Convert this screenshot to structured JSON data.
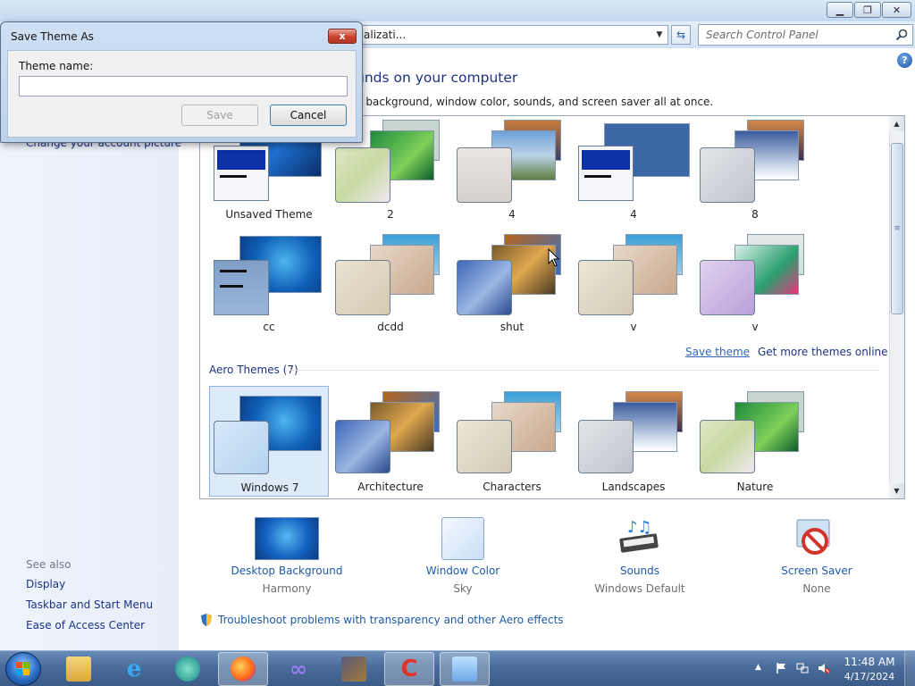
{
  "address": {
    "text": "alizati..."
  },
  "search": {
    "placeholder": "Search Control Panel"
  },
  "heading": "unds on your computer",
  "subheading": "p background, window color, sounds, and screen saver all at once.",
  "left_pane": {
    "partial_link": "Change your account picture",
    "see_also": "See also",
    "links": [
      "Display",
      "Taskbar and Start Menu",
      "Ease of Access Center"
    ]
  },
  "my_themes": [
    {
      "label": "Unsaved Theme",
      "icon": "basic-window-theme"
    },
    {
      "label": "2",
      "icon": "green-abstract-theme"
    },
    {
      "label": "4",
      "icon": "landscape-lighthouse-theme"
    },
    {
      "label": "4",
      "icon": "solid-blue-basic-theme"
    },
    {
      "label": "8",
      "icon": "sunset-landscape-theme"
    },
    {
      "label": "cc",
      "icon": "windows7-basic-theme"
    },
    {
      "label": "dcdd",
      "icon": "characters-theme"
    },
    {
      "label": "shut",
      "icon": "architecture-theme"
    },
    {
      "label": "v",
      "icon": "characters-theme"
    },
    {
      "label": "v",
      "icon": "purple-characters-theme"
    }
  ],
  "links": {
    "save_theme": "Save theme",
    "more_themes": "Get more themes online"
  },
  "aero": {
    "header": "Aero Themes (7)",
    "themes": [
      {
        "label": "Windows 7",
        "selected": true
      },
      {
        "label": "Architecture"
      },
      {
        "label": "Characters"
      },
      {
        "label": "Landscapes"
      },
      {
        "label": "Nature"
      }
    ]
  },
  "settings": [
    {
      "title": "Desktop Background",
      "value": "Harmony",
      "icon": "desktop-background-icon"
    },
    {
      "title": "Window Color",
      "value": "Sky",
      "icon": "window-color-icon"
    },
    {
      "title": "Sounds",
      "value": "Windows Default",
      "icon": "sounds-icon"
    },
    {
      "title": "Screen Saver",
      "value": "None",
      "icon": "screen-saver-icon"
    }
  ],
  "troubleshoot": "Troubleshoot problems with transparency and other Aero effects",
  "dialog": {
    "title": "Save Theme As",
    "label": "Theme name:",
    "input_value": "",
    "save_label": "Save",
    "cancel_label": "Cancel",
    "close_glyph": "x"
  },
  "clock": {
    "time": "11:48 AM",
    "date": "4/17/2024"
  },
  "colors": {
    "link": "#1e3287",
    "accent": "#1e5aa8",
    "taskbar": "#4a6c9a"
  }
}
